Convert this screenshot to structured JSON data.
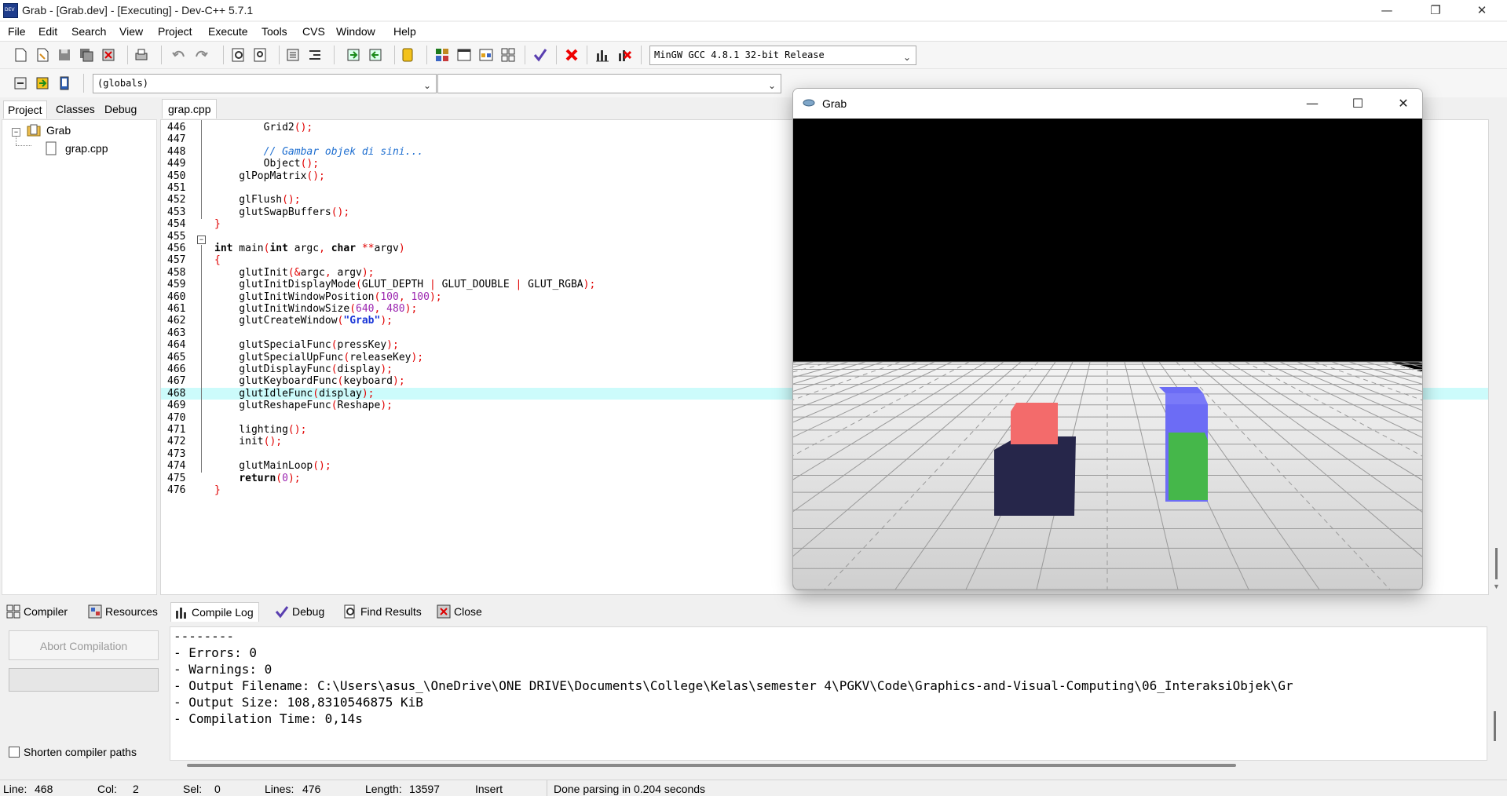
{
  "window": {
    "title": "Grab - [Grab.dev] - [Executing] - Dev-C++ 5.7.1",
    "minimize": "—",
    "restore": "❐",
    "close": "✕"
  },
  "menu": [
    "File",
    "Edit",
    "Search",
    "View",
    "Project",
    "Execute",
    "Tools",
    "CVS",
    "Window",
    "Help"
  ],
  "compiler_select": "MinGW GCC 4.8.1 32-bit Release",
  "scope_select": "(globals)",
  "function_select": "",
  "left_tabs": [
    "Project",
    "Classes",
    "Debug"
  ],
  "tree": {
    "project": "Grab",
    "file": "grap.cpp"
  },
  "editor": {
    "tab": "grap.cpp",
    "highlight_line": 468,
    "lines": [
      {
        "n": "446",
        "html": "        Grid2<span class='sym'>();</span>"
      },
      {
        "n": "447",
        "html": ""
      },
      {
        "n": "448",
        "html": "        <span class='cmt'>// Gambar objek di sini...</span>"
      },
      {
        "n": "449",
        "html": "        Object<span class='sym'>();</span>"
      },
      {
        "n": "450",
        "html": "    glPopMatrix<span class='sym'>();</span>"
      },
      {
        "n": "451",
        "html": ""
      },
      {
        "n": "452",
        "html": "    glFlush<span class='sym'>();</span>"
      },
      {
        "n": "453",
        "html": "    glutSwapBuffers<span class='sym'>();</span>"
      },
      {
        "n": "454",
        "html": "<span class='sym'>}</span>"
      },
      {
        "n": "455",
        "html": ""
      },
      {
        "n": "456",
        "html": "<span class='kw'>int</span> main<span class='sym'>(</span><span class='kw'>int</span> argc<span class='sym'>,</span> <span class='kw'>char</span> <span class='sym'>**</span>argv<span class='sym'>)</span>"
      },
      {
        "n": "457",
        "html": "<span class='sym'>{</span>"
      },
      {
        "n": "458",
        "html": "    glutInit<span class='sym'>(&amp;</span>argc<span class='sym'>,</span> argv<span class='sym'>);</span>"
      },
      {
        "n": "459",
        "html": "    glutInitDisplayMode<span class='sym'>(</span>GLUT_DEPTH <span class='sym'>|</span> GLUT_DOUBLE <span class='sym'>|</span> GLUT_RGBA<span class='sym'>);</span>"
      },
      {
        "n": "460",
        "html": "    glutInitWindowPosition<span class='sym'>(</span><span class='num'>100</span><span class='sym'>,</span> <span class='num'>100</span><span class='sym'>);</span>"
      },
      {
        "n": "461",
        "html": "    glutInitWindowSize<span class='sym'>(</span><span class='num'>640</span><span class='sym'>,</span> <span class='num'>480</span><span class='sym'>);</span>"
      },
      {
        "n": "462",
        "html": "    glutCreateWindow<span class='sym'>(</span><span class='str'>\"Grab\"</span><span class='sym'>);</span>"
      },
      {
        "n": "463",
        "html": ""
      },
      {
        "n": "464",
        "html": "    glutSpecialFunc<span class='sym'>(</span>pressKey<span class='sym'>);</span>"
      },
      {
        "n": "465",
        "html": "    glutSpecialUpFunc<span class='sym'>(</span>releaseKey<span class='sym'>);</span>"
      },
      {
        "n": "466",
        "html": "    glutDisplayFunc<span class='sym'>(</span>display<span class='sym'>);</span>"
      },
      {
        "n": "467",
        "html": "    glutKeyboardFunc<span class='sym'>(</span>keyboard<span class='sym'>);</span>"
      },
      {
        "n": "468",
        "html": "    glutIdleFunc<span class='sym'>(</span>display<span class='sym'>);</span>"
      },
      {
        "n": "469",
        "html": "    glutReshapeFunc<span class='sym'>(</span>Reshape<span class='sym'>);</span>"
      },
      {
        "n": "470",
        "html": ""
      },
      {
        "n": "471",
        "html": "    lighting<span class='sym'>();</span>"
      },
      {
        "n": "472",
        "html": "    init<span class='sym'>();</span>"
      },
      {
        "n": "473",
        "html": ""
      },
      {
        "n": "474",
        "html": "    glutMainLoop<span class='sym'>();</span>"
      },
      {
        "n": "475",
        "html": "    <span class='kw'>return</span><span class='sym'>(</span><span class='num'>0</span><span class='sym'>);</span>"
      },
      {
        "n": "476",
        "html": "<span class='sym'>}</span>"
      }
    ]
  },
  "bottom_tabs": [
    "Compiler",
    "Resources",
    "Compile Log",
    "Debug",
    "Find Results",
    "Close"
  ],
  "abort_button": "Abort Compilation",
  "shorten_paths_label": "Shorten compiler paths",
  "compile_log": [
    "--------",
    "- Errors: 0",
    "- Warnings: 0",
    "- Output Filename: C:\\Users\\asus_\\OneDrive\\ONE DRIVE\\Documents\\College\\Kelas\\semester 4\\PGKV\\Code\\Graphics-and-Visual-Computing\\06_InteraksiObjek\\Gr",
    "- Output Size: 108,8310546875 KiB",
    "- Compilation Time: 0,14s"
  ],
  "status": {
    "line_label": "Line:",
    "line": "468",
    "col_label": "Col:",
    "col": "2",
    "sel_label": "Sel:",
    "sel": "0",
    "lines_label": "Lines:",
    "lines": "476",
    "length_label": "Length:",
    "length": "13597",
    "mode": "Insert",
    "message": "Done parsing in 0.204 seconds"
  },
  "gl_window": {
    "title": "Grab",
    "minimize": "—",
    "maximize": "☐",
    "close": "✕"
  },
  "colors": {
    "highlight": "#ccfbfb",
    "cube_red": "#f36b6b",
    "cube_navy": "#26264a",
    "block_blue": "#6c6cf5",
    "block_green": "#45b74a"
  }
}
